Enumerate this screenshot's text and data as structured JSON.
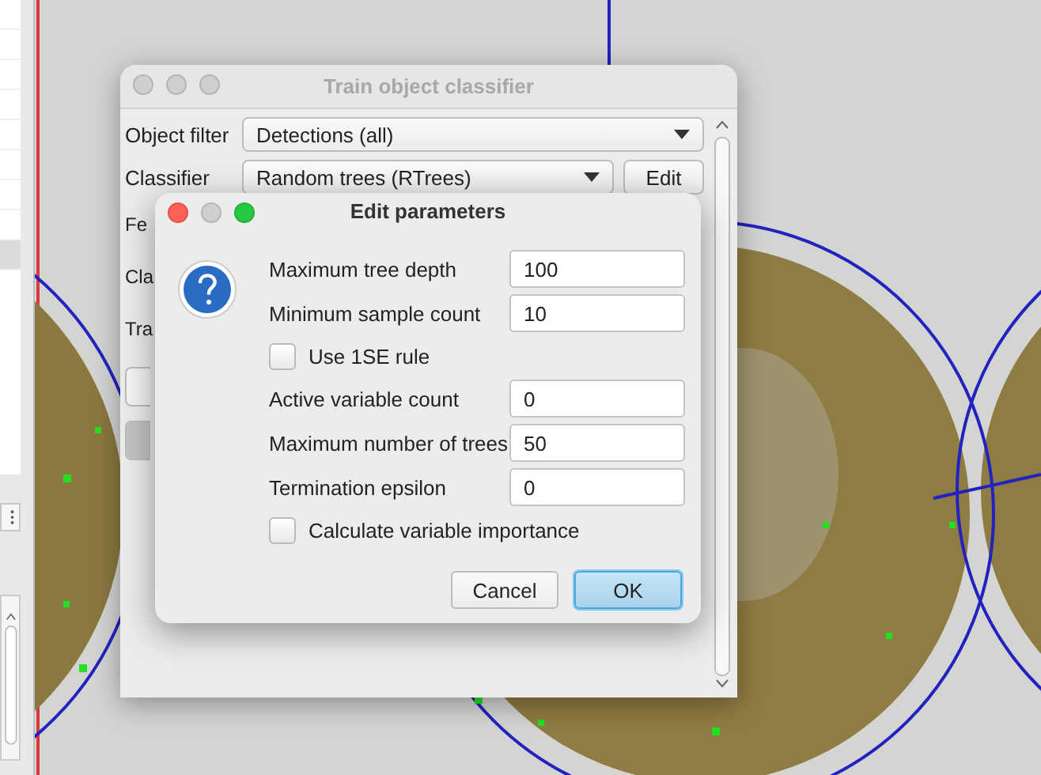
{
  "back_window": {
    "title": "Train object classifier",
    "rows": [
      {
        "label": "Object filter",
        "value": "Detections (all)"
      },
      {
        "label": "Classifier",
        "value": "Random trees (RTrees)",
        "button": "Edit"
      }
    ],
    "covered_labels": [
      "Fe",
      "Cla",
      "Tra"
    ]
  },
  "dialog": {
    "title": "Edit parameters",
    "params": [
      {
        "kind": "field",
        "label": "Maximum tree depth",
        "value": "100"
      },
      {
        "kind": "field",
        "label": "Minimum sample count",
        "value": "10"
      },
      {
        "kind": "checkbox",
        "label": "Use 1SE rule",
        "checked": false
      },
      {
        "kind": "field",
        "label": "Active variable count",
        "value": "0"
      },
      {
        "kind": "field",
        "label": "Maximum number of trees",
        "value": "50"
      },
      {
        "kind": "field",
        "label": "Termination epsilon",
        "value": "0"
      },
      {
        "kind": "checkbox",
        "label": "Calculate variable importance",
        "checked": false
      }
    ],
    "buttons": [
      {
        "label": "Cancel",
        "default": false
      },
      {
        "label": "OK",
        "default": true
      }
    ]
  }
}
